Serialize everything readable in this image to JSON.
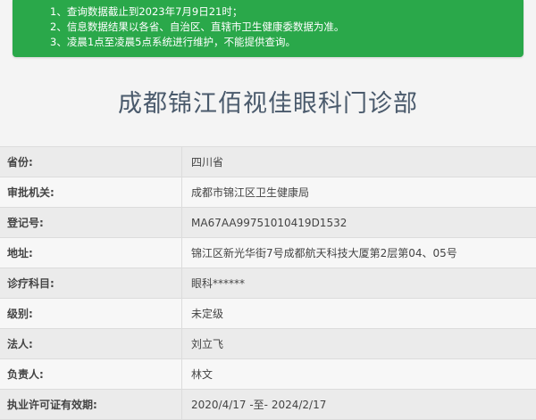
{
  "notice": {
    "lines": [
      "1、查询数据截止到2023年7月9日21时；",
      "2、信息数据结果以各省、自治区、直辖市卫生健康委数据为准。",
      "3、凌晨1点至凌晨5点系统进行维护，不能提供查询。"
    ]
  },
  "page": {
    "title": "成都锦江佰视佳眼科门诊部"
  },
  "details": [
    {
      "label": "省份:",
      "value": "四川省"
    },
    {
      "label": "审批机关:",
      "value": "成都市锦江区卫生健康局"
    },
    {
      "label": "登记号:",
      "value": "MA67AA99751010419D1532"
    },
    {
      "label": "地址:",
      "value": "锦江区新光华街7号成都航天科技大厦第2层第04、05号"
    },
    {
      "label": "诊疗科目:",
      "value": "眼科******"
    },
    {
      "label": "级别:",
      "value": "未定级"
    },
    {
      "label": "法人:",
      "value": "刘立飞"
    },
    {
      "label": "负责人:",
      "value": "林文"
    },
    {
      "label": "执业许可证有效期:",
      "value": "2020/4/17 -至- 2024/2/17"
    }
  ]
}
